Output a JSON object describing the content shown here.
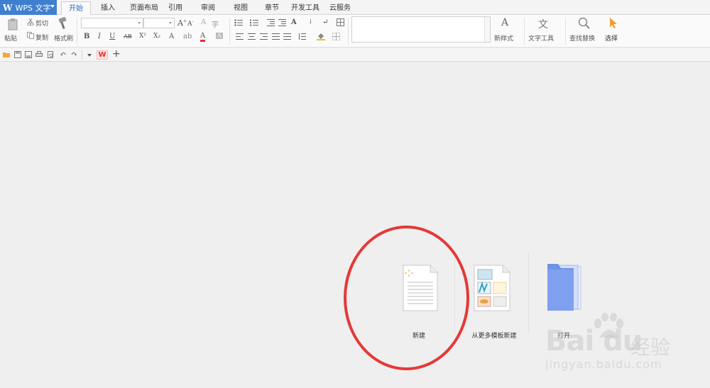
{
  "app": {
    "name": "WPS 文字",
    "logo": "W"
  },
  "tabs": [
    {
      "label": "开始",
      "active": true
    },
    {
      "label": "插入"
    },
    {
      "label": "页面布局"
    },
    {
      "label": "引用"
    },
    {
      "label": "审阅"
    },
    {
      "label": "视图"
    },
    {
      "label": "章节"
    },
    {
      "label": "开发工具"
    },
    {
      "label": "云服务"
    }
  ],
  "ribbon": {
    "paste": "粘贴",
    "cut": "剪切",
    "copy": "复制",
    "format_painter": "格式刷",
    "font_family_value": "",
    "font_size_value": "",
    "bold": "B",
    "italic": "I",
    "underline": "U",
    "strike": "AB",
    "superscript": "X²",
    "subscript": "X₂",
    "new_style": "新样式",
    "text_tools": "文字工具",
    "find_replace": "查找替换",
    "select": "选择"
  },
  "start": {
    "new": "新建",
    "from_template": "从更多模板新建",
    "open": "打开"
  },
  "watermark": {
    "logo": "Bai du",
    "cn": "经验",
    "url": "jingyan.baidu.com"
  },
  "colors": {
    "brand_blue": "#3f7fd0",
    "active_tab_text": "#2a6bc8",
    "highlight_circle": "#e53838",
    "folder_blue": "#6f93e6"
  }
}
